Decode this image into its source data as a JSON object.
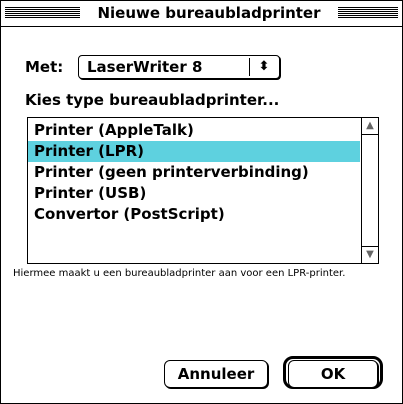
{
  "window": {
    "title": "Nieuwe bureaubladprinter"
  },
  "driver": {
    "label": "Met:",
    "selected": "LaserWriter 8",
    "arrows_glyph": "⬍"
  },
  "list": {
    "heading": "Kies type bureaubladprinter...",
    "items": [
      {
        "label": "Printer (AppleTalk)",
        "selected": false
      },
      {
        "label": "Printer (LPR)",
        "selected": true
      },
      {
        "label": "Printer (geen printerverbinding)",
        "selected": false
      },
      {
        "label": "Printer (USB)",
        "selected": false
      },
      {
        "label": "Convertor (PostScript)",
        "selected": false
      }
    ],
    "selection_color": "#5ed1df",
    "scroll_up_icon": "▲",
    "scroll_down_icon": "▼"
  },
  "description": "Hiermee maakt u een bureaubladprinter aan voor een LPR-printer.",
  "buttons": {
    "cancel": "Annuleer",
    "ok": "OK"
  }
}
